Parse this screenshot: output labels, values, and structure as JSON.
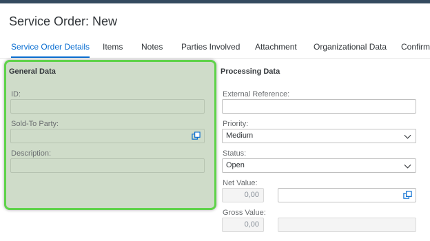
{
  "page": {
    "title": "Service Order: New"
  },
  "tabs": [
    {
      "label": "Service Order Details",
      "active": true
    },
    {
      "label": "Items",
      "active": false
    },
    {
      "label": "Notes",
      "active": false
    },
    {
      "label": "Parties Involved",
      "active": false
    },
    {
      "label": "Attachment",
      "active": false
    },
    {
      "label": "Organizational Data",
      "active": false
    },
    {
      "label": "Confirma",
      "active": false
    }
  ],
  "general_data": {
    "title": "General Data",
    "id_label": "ID:",
    "id_value": "",
    "sold_to_label": "Sold-To Party:",
    "sold_to_value": "",
    "sold_to_icon": "value-help-icon",
    "description_label": "Description:",
    "description_value": ""
  },
  "processing_data": {
    "title": "Processing Data",
    "external_reference_label": "External Reference:",
    "external_reference_value": "",
    "priority_label": "Priority:",
    "priority_value": "Medium",
    "status_label": "Status:",
    "status_value": "Open",
    "net_value_label": "Net Value:",
    "net_value_amount": "0,00",
    "net_value_currency": "",
    "net_value_icon": "value-help-icon",
    "gross_value_label": "Gross Value:",
    "gross_value_amount": "0,00",
    "gross_value_currency": ""
  },
  "colors": {
    "accent": "#0a6ed1",
    "highlight_border": "#5fd34a",
    "highlight_fill": "#cfdcc9",
    "shell_bar": "#354a5f"
  }
}
